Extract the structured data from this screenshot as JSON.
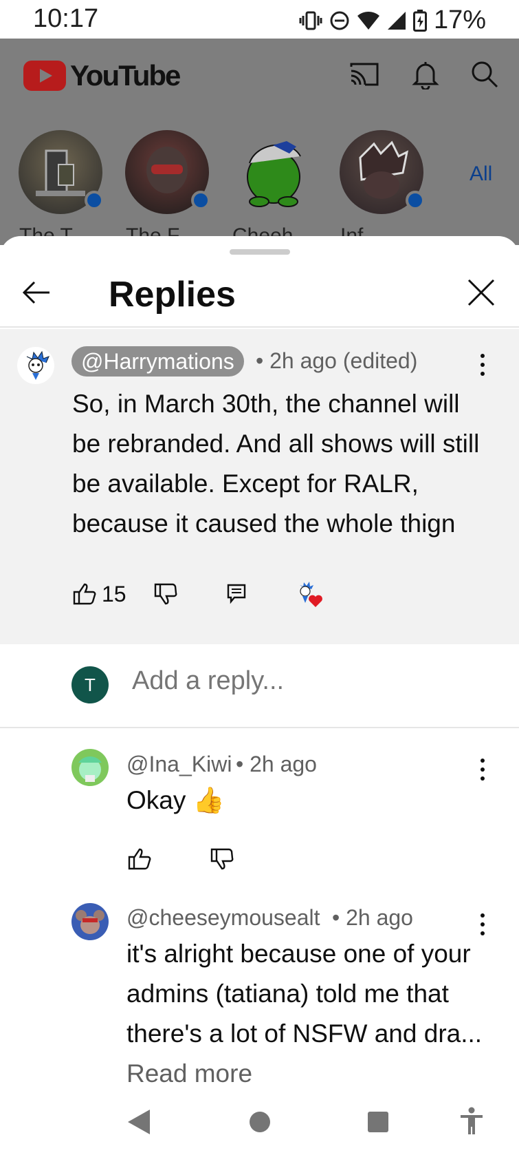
{
  "status_bar": {
    "time": "10:17",
    "battery_percent": "17%",
    "icons": [
      "vibrate-icon",
      "do-not-disturb-icon",
      "wifi-icon",
      "signal-icon",
      "battery-icon"
    ]
  },
  "youtube": {
    "logo_text": "YouTube",
    "all_label": "All",
    "story_names": [
      "The T...",
      "The F...",
      "Cheeh...",
      "Inf..."
    ]
  },
  "sheet": {
    "title": "Replies"
  },
  "parent_comment": {
    "handle": "@Harrymations",
    "meta": "• 2h ago (edited)",
    "text": "So, in March 30th, the channel will be rebranded. And all shows will still be available. Except for RALR, because it caused the whole thign",
    "likes": "15"
  },
  "reply_box": {
    "avatar_letter": "T",
    "placeholder": "Add a reply..."
  },
  "replies": [
    {
      "handle": "@Ina_Kiwi",
      "meta": "• 2h ago",
      "text": "Okay 👍"
    },
    {
      "handle": "@cheeseymousealt",
      "meta": "• 2h ago",
      "text": "it's alright because one of your admins (tatiana) told me that there's a lot of NSFW and dra...",
      "read_more": "Read more"
    }
  ],
  "colors": {
    "dim_background": "#7e7e7e",
    "parent_background": "#f2f2f2",
    "handle_pill": "#8f8f8f",
    "reply_avatar": "#11554a",
    "heart": "#e01b24"
  }
}
